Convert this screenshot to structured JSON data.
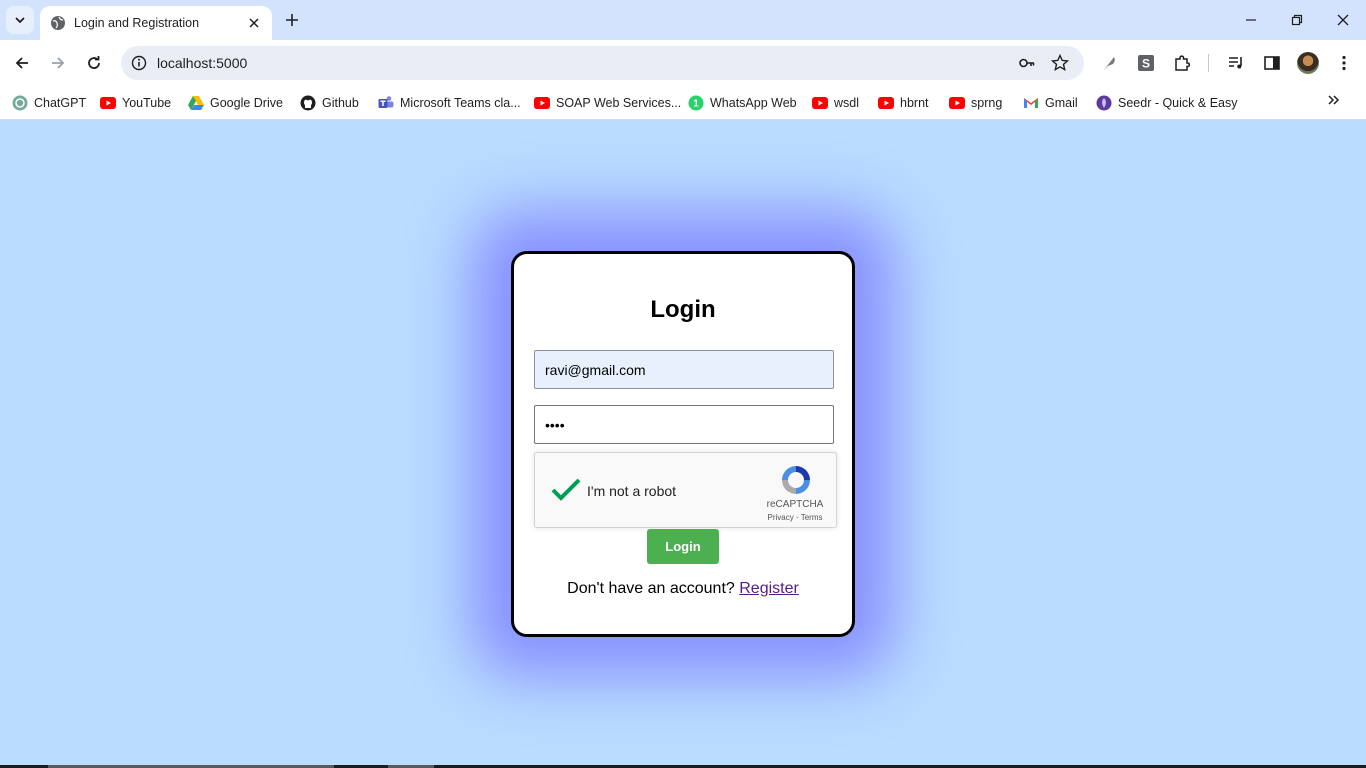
{
  "browser": {
    "tab": {
      "title": "Login and Registration"
    },
    "url": "localhost:5000",
    "bookmarks": [
      {
        "label": "ChatGPT",
        "icon": "chatgpt-icon"
      },
      {
        "label": "YouTube",
        "icon": "youtube-icon"
      },
      {
        "label": "Google Drive",
        "icon": "google-drive-icon"
      },
      {
        "label": "Github",
        "icon": "github-icon"
      },
      {
        "label": "Microsoft Teams cla...",
        "icon": "teams-icon"
      },
      {
        "label": "SOAP Web Services...",
        "icon": "youtube-icon"
      },
      {
        "label": "WhatsApp Web",
        "icon": "whatsapp-icon"
      },
      {
        "label": "wsdl",
        "icon": "youtube-icon"
      },
      {
        "label": "hbrnt",
        "icon": "youtube-icon"
      },
      {
        "label": "sprng",
        "icon": "youtube-icon"
      },
      {
        "label": "Gmail",
        "icon": "gmail-icon"
      },
      {
        "label": "Seedr - Quick & Easy",
        "icon": "seedr-icon"
      }
    ],
    "whatsapp_badge": "1"
  },
  "login": {
    "title": "Login",
    "email_value": "ravi@gmail.com",
    "password_value": "1234",
    "recaptcha": {
      "label": "I'm not a robot",
      "brand": "reCAPTCHA",
      "links": "Privacy - Terms",
      "checked": true
    },
    "button_label": "Login",
    "register_prompt": "Don't have an account?",
    "register_link": "Register"
  },
  "colors": {
    "page_background": "#b9dcff",
    "card_glow": "#7878ff",
    "login_button": "#4caf50",
    "link": "#551a8b",
    "recaptcha_check": "#009e55"
  }
}
